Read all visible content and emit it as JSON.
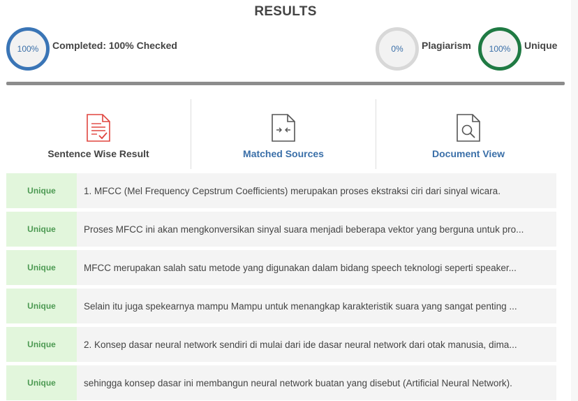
{
  "header": {
    "title": "RESULTS"
  },
  "stats": {
    "completed": {
      "value": "100%",
      "label": "Completed: 100% Checked"
    },
    "plagiarism": {
      "value": "0%",
      "label": "Plagiarism"
    },
    "unique": {
      "value": "100%",
      "label": "Unique"
    }
  },
  "colors": {
    "completed_ring": "#3a75b6",
    "plagiarism_ring": "#d8d8d8",
    "unique_ring": "#1f7a43",
    "link": "#3a6fa8",
    "unique_badge_bg": "#e2f6dc",
    "unique_badge_text": "#4d9a53"
  },
  "tabs": [
    {
      "label": "Sentence Wise Result",
      "icon": "checked-document-icon"
    },
    {
      "label": "Matched Sources",
      "icon": "compare-document-icon"
    },
    {
      "label": "Document View",
      "icon": "search-document-icon"
    }
  ],
  "results": [
    {
      "status": "Unique",
      "text": "1. MFCC (Mel Frequency Cepstrum Coefficients) merupakan proses ekstraksi ciri dari sinyal wicara."
    },
    {
      "status": "Unique",
      "text": "Proses MFCC ini akan mengkonversikan sinyal suara menjadi beberapa vektor yang berguna untuk pro..."
    },
    {
      "status": "Unique",
      "text": "MFCC merupakan salah satu metode yang digunakan dalam bidang speech teknologi seperti speaker..."
    },
    {
      "status": "Unique",
      "text": "Selain itu juga spekearnya mampu Mampu untuk menangkap karakteristik suara yang sangat penting ..."
    },
    {
      "status": "Unique",
      "text": "2. Konsep dasar neural network sendiri di mulai dari ide dasar neural network dari otak manusia, dima..."
    },
    {
      "status": "Unique",
      "text": "sehingga konsep dasar ini membangun neural network buatan yang disebut (Artificial Neural Network)."
    }
  ]
}
